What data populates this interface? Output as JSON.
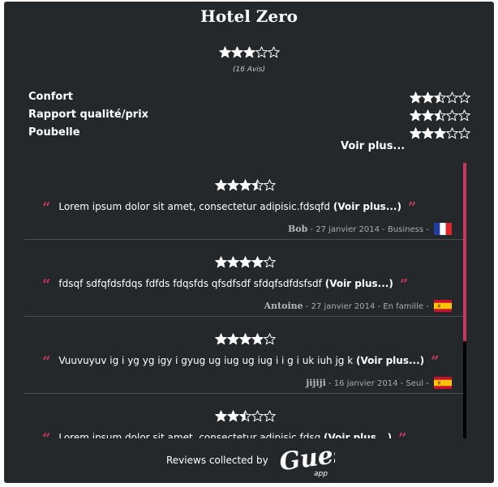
{
  "hotel": {
    "name": "Hotel Zero"
  },
  "overall": {
    "rating": 3,
    "max": 5,
    "count_text": "(16 Avis)"
  },
  "criteria": [
    {
      "label": "Confort",
      "rating": 2.5
    },
    {
      "label": "Rapport qualité/prix",
      "rating": 2.5
    },
    {
      "label": "Poubelle",
      "rating": 3
    }
  ],
  "voir_plus": "Voir plus...",
  "reviews": [
    {
      "rating": 3.5,
      "text": "Lorem ipsum dolor sit amet, consectetur adipisic.fdsqfd",
      "more": "(Voir plus...)",
      "author": "Bob",
      "details": " - 27 janvier 2014 - Business - ",
      "flag": "france-flag"
    },
    {
      "rating": 4,
      "text": "fdsqf sdfqfdsfdqs fdfds fdqsfds qfsdfsdf sfdqfsdfdsfsdf",
      "more": "(Voir plus...)",
      "author": "Antoine",
      "details": " - 27 janvier 2014 - En famille - ",
      "flag": "spain-flag"
    },
    {
      "rating": 4,
      "text": "Vuuvuyuv ig i yg yg igy i gyug ug iug ug iug i i g i uk iuh jg k",
      "more": "(Voir plus...)",
      "author": "jijiji",
      "details": " - 16 janvier 2014 - Seul - ",
      "flag": "spain-flag"
    },
    {
      "rating": 2.5,
      "text": "Lorem ipsum dolor sit amet, consectetur adipisic.fdsq",
      "more": "(Voir plus...)",
      "author": "",
      "details": "",
      "flag": ""
    }
  ],
  "footer": {
    "text": "Reviews collected by",
    "logo_text": "Guest",
    "logo_sub": "app",
    "logo_icon": "guestapp-logo"
  },
  "colors": {
    "background": "#24282b",
    "accent": "#c8385a",
    "star": "#ffffff"
  }
}
